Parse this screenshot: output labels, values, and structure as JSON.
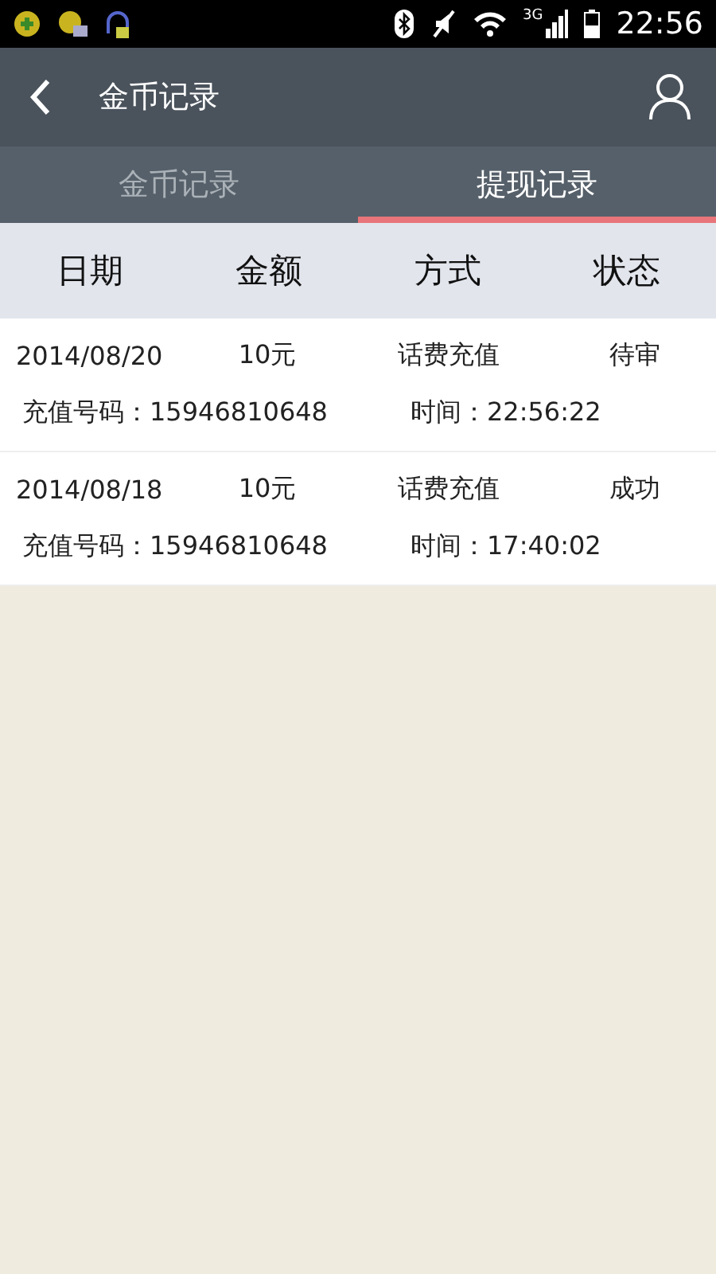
{
  "status_bar": {
    "network": "3G",
    "time": "22:56"
  },
  "app_bar": {
    "title": "金币记录"
  },
  "tabs": [
    {
      "label": "金币记录",
      "selected": false
    },
    {
      "label": "提现记录",
      "selected": true
    }
  ],
  "table": {
    "columns": [
      "日期",
      "金额",
      "方式",
      "状态"
    ],
    "rows": [
      {
        "date": "2014/08/20",
        "amount": "10元",
        "method": "话费充值",
        "status": "待审",
        "phone": "充值号码：15946810648",
        "time": "时间：22:56:22"
      },
      {
        "date": "2014/08/18",
        "amount": "10元",
        "method": "话费充值",
        "status": "成功",
        "phone": "充值号码：15946810648",
        "time": "时间：17:40:02"
      }
    ]
  }
}
